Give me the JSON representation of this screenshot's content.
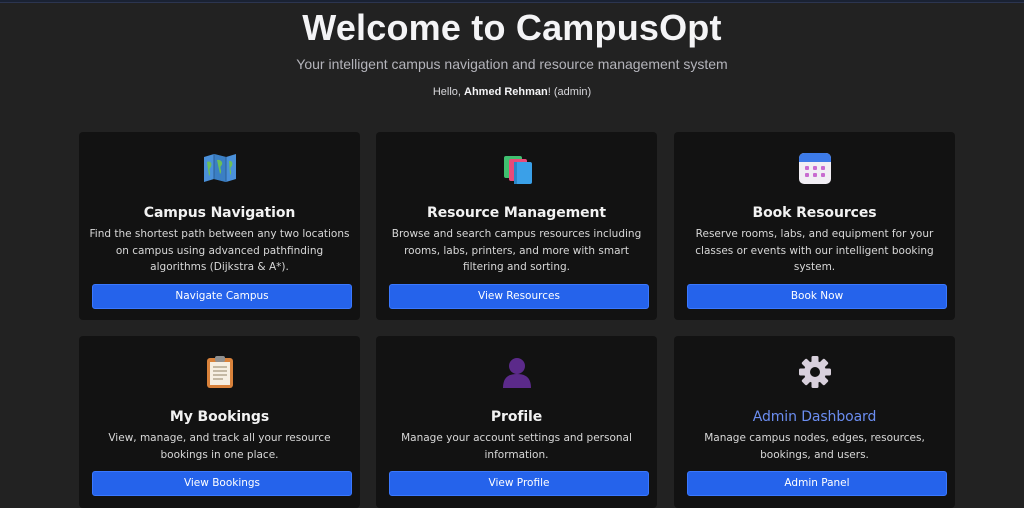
{
  "header": {
    "title": "Welcome to CampusOpt",
    "subtitle": "Your intelligent campus navigation and resource management system",
    "greeting_prefix": "Hello, ",
    "user_name": "Ahmed Rehman",
    "greeting_suffix": "! (admin)"
  },
  "cards": [
    {
      "icon": "map-icon",
      "title": "Campus Navigation",
      "description": "Find the shortest path between any two locations on campus using advanced pathfinding algorithms (Dijkstra & A*).",
      "button": "Navigate Campus"
    },
    {
      "icon": "books-icon",
      "title": "Resource Management",
      "description": "Browse and search campus resources including rooms, labs, printers, and more with smart filtering and sorting.",
      "button": "View Resources"
    },
    {
      "icon": "calendar-icon",
      "title": "Book Resources",
      "description": "Reserve rooms, labs, and equipment for your classes or events with our intelligent booking system.",
      "button": "Book Now"
    },
    {
      "icon": "clipboard-icon",
      "title": "My Bookings",
      "description": "View, manage, and track all your resource bookings in one place.",
      "button": "View Bookings"
    },
    {
      "icon": "user-silhouette-icon",
      "title": "Profile",
      "description": "Manage your account settings and personal information.",
      "button": "View Profile"
    },
    {
      "icon": "gear-icon",
      "title": "Admin Dashboard",
      "description": "Manage campus nodes, edges, resources, bookings, and users.",
      "button": "Admin Panel"
    }
  ],
  "colors": {
    "background": "#222222",
    "card": "#121212",
    "button": "#2563eb",
    "accent_title": "#6b8df0"
  }
}
